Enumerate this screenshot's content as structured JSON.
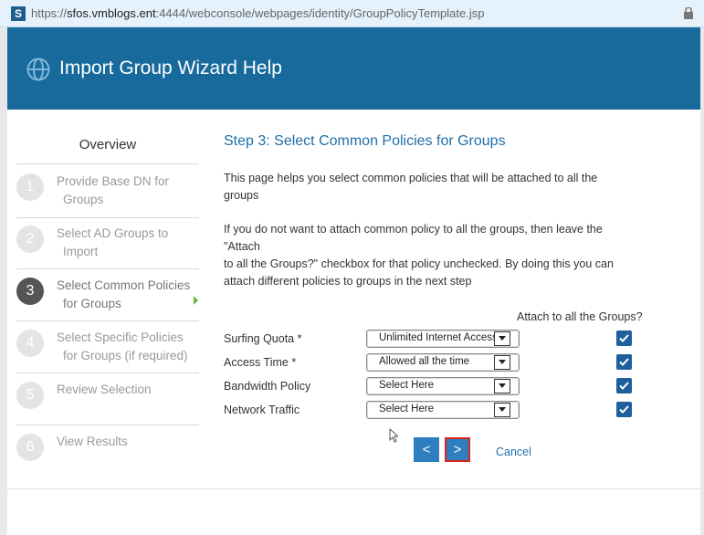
{
  "browser": {
    "url_prefix": "https://",
    "url_host": "sfos.vmblogs.ent",
    "url_rest": ":4444/webconsole/webpages/identity/GroupPolicyTemplate.jsp",
    "site_icon": "S"
  },
  "header": {
    "title": "Import Group Wizard Help"
  },
  "sidebar": {
    "overview": "Overview",
    "steps": [
      {
        "num": "1",
        "line1": "Provide Base DN for",
        "line2": "Groups",
        "active": false
      },
      {
        "num": "2",
        "line1": "Select AD Groups to",
        "line2": "Import",
        "active": false
      },
      {
        "num": "3",
        "line1": "Select Common Policies",
        "line2": "for Groups",
        "active": true
      },
      {
        "num": "4",
        "line1": "Select Specific Policies",
        "line2": "for Groups (if required)",
        "active": false
      },
      {
        "num": "5",
        "line1": "Review Selection",
        "line2": "",
        "active": false
      },
      {
        "num": "6",
        "line1": "View Results",
        "line2": "",
        "active": false
      }
    ]
  },
  "main": {
    "step_title": "Step 3: Select Common Policies for Groups",
    "para1_line1": "This page helps you select common policies that will be attached to all the",
    "para1_line2": "groups",
    "para2_line1": "If you do not want to attach common policy to all the groups, then leave the",
    "para2_line2": "\"Attach",
    "para2_line3": "to all the Groups?\" checkbox for that policy unchecked. By doing this you can",
    "para2_line4": "attach different policies to groups in the next step",
    "attach_header": "Attach to all the Groups?",
    "policies": [
      {
        "label": "Surfing Quota *",
        "value": "Unlimited Internet Access",
        "checked": true
      },
      {
        "label": "Access Time *",
        "value": "Allowed all the time",
        "checked": true
      },
      {
        "label": "Bandwidth Policy",
        "value": "Select Here",
        "checked": true
      },
      {
        "label": "Network Traffic",
        "value": "Select Here",
        "checked": true
      }
    ],
    "prev_label": "<",
    "next_label": ">",
    "cancel_label": "Cancel"
  },
  "colors": {
    "header_bg": "#176a9b",
    "accent_blue": "#1f6fa8",
    "button_blue": "#2f7fc0",
    "next_border": "#d9251d",
    "active_step": "#555555"
  }
}
